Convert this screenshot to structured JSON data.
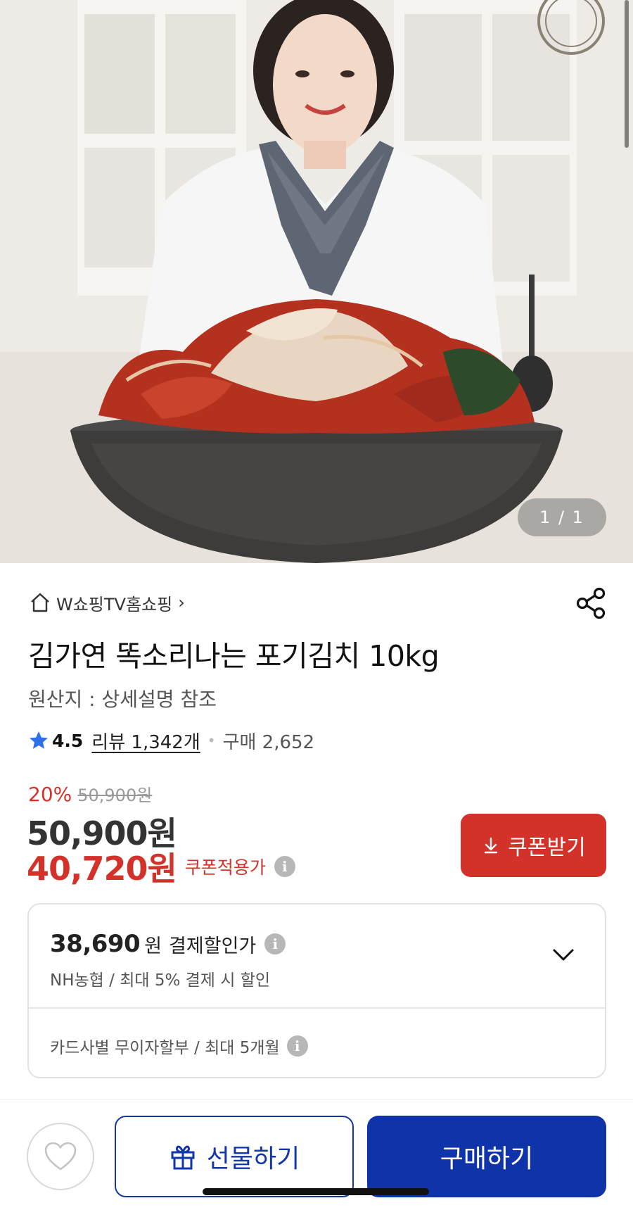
{
  "hero": {
    "image_label": "김가연 포기김치 product photo",
    "counter": "1 / 1"
  },
  "store": {
    "name": "W쇼핑TV홈쇼핑",
    "chevron": "›"
  },
  "product": {
    "title": "김가연 똑소리나는 포기김치 10kg",
    "origin": "원산지 : 상세설명 참조",
    "rating": "4.5",
    "reviews": "리뷰 1,342개",
    "purchases": "구매 2,652"
  },
  "pricing": {
    "discount_percent": "20%",
    "original_price": "50,900원",
    "price": "50,900원",
    "coupon_price": "40,720원",
    "coupon_label": "쿠폰적용가",
    "coupon_button": "쿠폰받기"
  },
  "payment": {
    "price": "38,690",
    "unit": "원",
    "label": "결제할인가",
    "desc": "NH농협 / 최대 5% 결제 시 할인",
    "installment": "카드사별 무이자할부 / 최대 5개월"
  },
  "bottom_bar": {
    "gift_label": "선물하기",
    "buy_label": "구매하기"
  },
  "colors": {
    "accent_red": "#d3322a",
    "brand_blue": "#0f33a8",
    "star_blue": "#2f6fe8"
  },
  "icons": [
    "home-icon",
    "chevron-right-icon",
    "share-icon",
    "star-icon",
    "info-icon",
    "download-icon",
    "chevron-down-icon",
    "heart-icon",
    "gift-icon"
  ]
}
